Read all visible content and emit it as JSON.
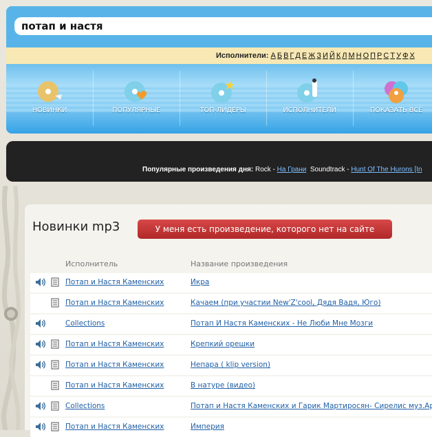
{
  "search": {
    "value": "потап и настя"
  },
  "artists": {
    "label": "Исполнители:",
    "letters": [
      "А",
      "Б",
      "В",
      "Г",
      "Д",
      "Е",
      "Ж",
      "З",
      "И",
      "Й",
      "К",
      "Л",
      "М",
      "Н",
      "О",
      "П",
      "Р",
      "С",
      "Т",
      "У",
      "Ф",
      "Х"
    ]
  },
  "nav": {
    "items": [
      {
        "label": "НОВИНКИ"
      },
      {
        "label": "ПОПУЛЯРНЫЕ"
      },
      {
        "label": "ТОП-ЛИДЕРЫ"
      },
      {
        "label": "ИСПОЛНИТЕЛИ"
      },
      {
        "label": "ПОКАЗАТЬ ВСЁ"
      }
    ]
  },
  "popular": {
    "label": "Популярные произведения дня:",
    "genre1": "Rock",
    "song1": "На Грани",
    "genre2": "Soundtrack",
    "song2": "Hunt Of The Hurons [In"
  },
  "main": {
    "title": "Новинки mp3",
    "request_button": "У меня есть произведение, которого нет на сайте",
    "col_artist": "Исполнитель",
    "col_song": "Название произведения"
  },
  "rows": [
    {
      "artist": "Потап и Настя Каменских",
      "song": "Икра"
    },
    {
      "artist": "Потап и Настя Каменских",
      "song": "Качаем (при участии New'Z'cool, Дядя Вадя, Юго)"
    },
    {
      "artist": "Collections",
      "song": "Потап И Настя Каменских - Не Люби Мне Мозги"
    },
    {
      "artist": "Потап и Настя Каменских",
      "song": "Крепкий орешки"
    },
    {
      "artist": "Потап и Настя Каменских",
      "song": "Непара ( klip version)"
    },
    {
      "artist": "Потап и Настя Каменских",
      "song": "В натуре (видео)"
    },
    {
      "artist": "Collections",
      "song": "Потап и Настя Каменских и Гарик Мартиросян- Сирелис муз.Арм"
    },
    {
      "artist": "Потап и Настя Каменских",
      "song": "Империя"
    }
  ],
  "colors": {
    "accent_blue": "#58b4e8",
    "button_red": "#c03434",
    "link": "#1f5fa6",
    "dark_band": "#222222"
  }
}
